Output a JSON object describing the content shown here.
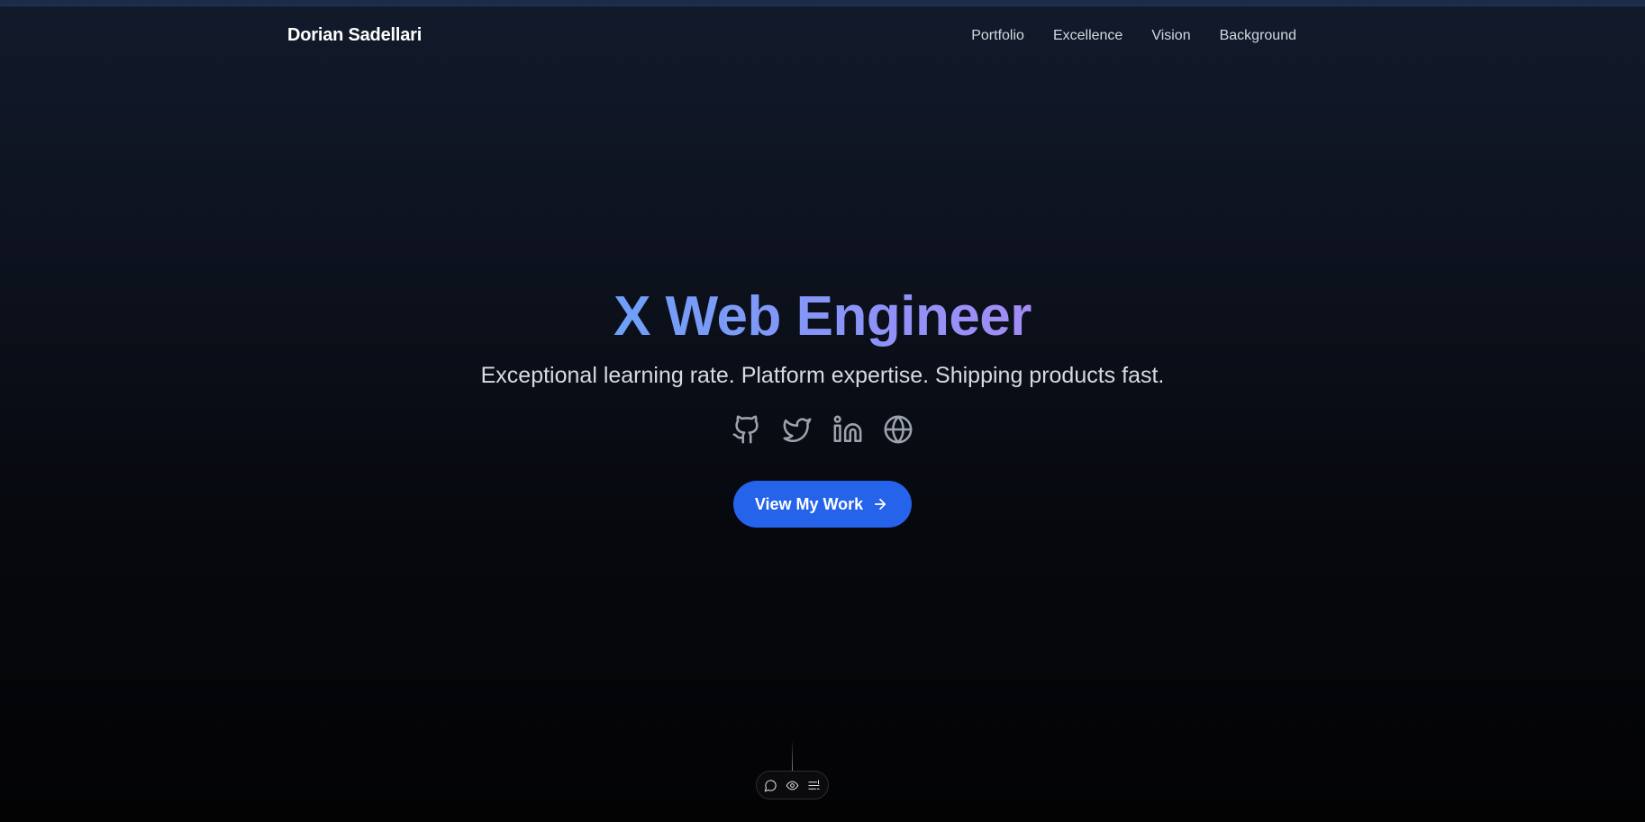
{
  "brand": {
    "name": "Dorian Sadellari"
  },
  "nav": {
    "items": [
      {
        "label": "Portfolio"
      },
      {
        "label": "Excellence"
      },
      {
        "label": "Vision"
      },
      {
        "label": "Background"
      }
    ]
  },
  "hero": {
    "title": "X Web Engineer",
    "subtitle": "Exceptional learning rate. Platform expertise. Shipping products fast.",
    "social_icons": [
      "github-icon",
      "twitter-icon",
      "linkedin-icon",
      "globe-icon"
    ],
    "cta": {
      "label": "View My Work",
      "icon": "arrow-right-icon"
    }
  },
  "toolbar": {
    "icons": [
      "comment-icon",
      "eye-icon",
      "settings-list-icon"
    ]
  },
  "colors": {
    "accent": "#2563eb",
    "title_gradient_start": "#6ea0f8",
    "title_gradient_end": "#a38cf6",
    "background_top": "#121a2b",
    "background_bottom": "#030304",
    "nav_text": "#d4d8e0",
    "icon_gray": "#9ca3af"
  }
}
